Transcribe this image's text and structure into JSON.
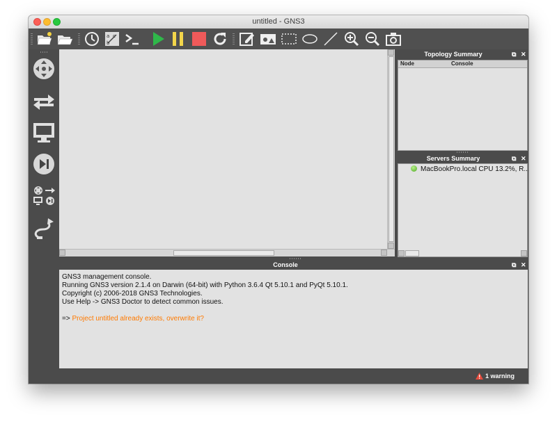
{
  "window": {
    "title": "untitled - GNS3"
  },
  "toolbar": {
    "buttons": [
      "new-project-icon",
      "open-project-icon",
      "snapshot-icon",
      "show-interface-labels-icon",
      "console-all-icon",
      "start-all-icon",
      "suspend-all-icon",
      "stop-all-icon",
      "reload-all-icon",
      "add-note-icon",
      "insert-image-icon",
      "draw-rectangle-icon",
      "draw-ellipse-icon",
      "draw-line-icon",
      "zoom-in-icon",
      "zoom-out-icon",
      "screenshot-icon"
    ],
    "colors": {
      "start": "#2fb84a",
      "suspend": "#f2d54a",
      "stop": "#f05a5a"
    }
  },
  "devices": [
    "router-icon",
    "switch-icon",
    "end-device-icon",
    "security-device-icon",
    "all-devices-icon",
    "add-link-icon"
  ],
  "topology": {
    "title": "Topology Summary",
    "columns": [
      "Node",
      "Console"
    ]
  },
  "servers": {
    "title": "Servers Summary",
    "row": "MacBookPro.local CPU 13.2%, R..."
  },
  "console": {
    "title": "Console",
    "lines": [
      "GNS3 management console.",
      "Running GNS3 version 2.1.4 on Darwin (64-bit) with Python 3.6.4 Qt 5.10.1 and PyQt 5.10.1.",
      "Copyright (c) 2006-2018 GNS3 Technologies.",
      "Use Help -> GNS3 Doctor to detect common issues."
    ],
    "prompt": "=> ",
    "prompt_message": "Project untitled already exists, overwrite it?"
  },
  "status": {
    "warning": "1 warning"
  }
}
